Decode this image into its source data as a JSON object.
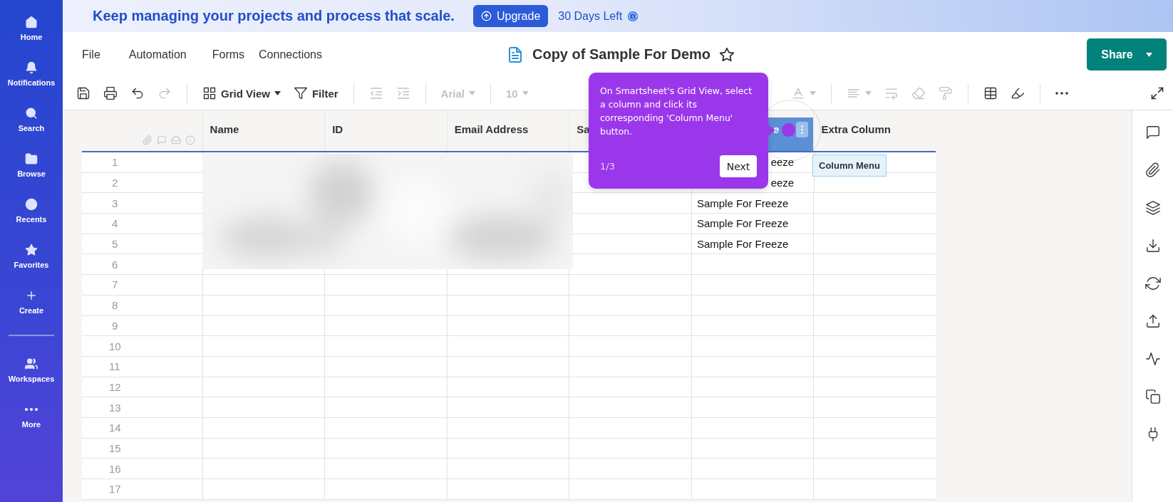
{
  "banner": {
    "message": "Keep managing your projects and process that scale.",
    "upgrade_button": "Upgrade",
    "trial_text": "30 Days Left"
  },
  "sidebar": {
    "items": [
      {
        "kind": "home",
        "label": "Home",
        "divider_before": false
      },
      {
        "kind": "bell",
        "label": "Notifications",
        "divider_before": false
      },
      {
        "kind": "search",
        "label": "Search",
        "divider_before": false
      },
      {
        "kind": "folder",
        "label": "Browse",
        "divider_before": false
      },
      {
        "kind": "clock",
        "label": "Recents",
        "divider_before": false
      },
      {
        "kind": "star",
        "label": "Favorites",
        "divider_before": false
      },
      {
        "kind": "plus",
        "label": "Create",
        "divider_before": false
      },
      {
        "kind": "workspaces",
        "label": "Workspaces",
        "divider_before": true
      },
      {
        "kind": "more",
        "label": "More",
        "divider_before": false
      }
    ]
  },
  "menu": [
    "File",
    "Automation",
    "Forms",
    "Connections"
  ],
  "document": {
    "title": "Copy of Sample For Demo",
    "starred": false
  },
  "share_button": {
    "label": "Share"
  },
  "toolbar": {
    "left_items": [
      {
        "kind": "save",
        "disabled": false,
        "dropdown": false
      },
      {
        "kind": "print",
        "disabled": false,
        "dropdown": false
      },
      {
        "kind": "undo",
        "disabled": false,
        "dropdown": false
      },
      {
        "kind": "redo",
        "disabled": true,
        "dropdown": false
      },
      {
        "kind": "divider"
      },
      {
        "kind": "grid-view",
        "label": "Grid View",
        "disabled": false,
        "dropdown": true
      },
      {
        "kind": "filter",
        "label": "Filter",
        "disabled": false,
        "dropdown": false
      },
      {
        "kind": "divider"
      },
      {
        "kind": "outdent",
        "disabled": true,
        "dropdown": false
      },
      {
        "kind": "indent",
        "disabled": true,
        "dropdown": false
      },
      {
        "kind": "divider"
      },
      {
        "kind": "font",
        "label": "Arial",
        "disabled": true,
        "dropdown": true
      },
      {
        "kind": "divider"
      },
      {
        "kind": "font-size",
        "label": "10",
        "disabled": true,
        "dropdown": true
      }
    ],
    "right_items": [
      {
        "kind": "text-color",
        "disabled": true,
        "dropdown": true
      },
      {
        "kind": "divider"
      },
      {
        "kind": "align",
        "disabled": true,
        "dropdown": true
      },
      {
        "kind": "wrap",
        "disabled": true,
        "dropdown": false
      },
      {
        "kind": "eraser",
        "disabled": true,
        "dropdown": false
      },
      {
        "kind": "paint-roller",
        "disabled": true,
        "dropdown": false
      },
      {
        "kind": "divider"
      },
      {
        "kind": "table",
        "disabled": false,
        "dropdown": false
      },
      {
        "kind": "highlighter",
        "disabled": false,
        "dropdown": false
      },
      {
        "kind": "divider"
      },
      {
        "kind": "more",
        "disabled": false,
        "dropdown": false
      }
    ]
  },
  "grid": {
    "columns": [
      {
        "label": "Name",
        "selected": false
      },
      {
        "label": "ID",
        "selected": false
      },
      {
        "label": "Email Address",
        "selected": false
      },
      {
        "label": "Sa",
        "selected": false
      },
      {
        "label": "e",
        "selected": true
      },
      {
        "label": "Extra Column",
        "selected": false
      }
    ],
    "rows": [
      {
        "number": "1",
        "column_5": {
          "text": "eeze",
          "clipped": true
        }
      },
      {
        "number": "2",
        "column_5": {
          "text": "eeze",
          "clipped": true
        }
      },
      {
        "number": "3",
        "column_5": {
          "text": "Sample For Freeze",
          "clipped": false
        }
      },
      {
        "number": "4",
        "column_5": {
          "text": "Sample For Freeze",
          "clipped": false
        }
      },
      {
        "number": "5",
        "column_5": {
          "text": "Sample For Freeze",
          "clipped": false
        }
      },
      {
        "number": "6"
      },
      {
        "number": "7"
      },
      {
        "number": "8"
      },
      {
        "number": "9"
      },
      {
        "number": "10"
      },
      {
        "number": "11"
      },
      {
        "number": "12"
      },
      {
        "number": "13"
      },
      {
        "number": "14"
      },
      {
        "number": "15"
      },
      {
        "number": "16"
      },
      {
        "number": "17"
      }
    ]
  },
  "column_menu_tooltip": "Column Menu",
  "tour": {
    "text": "On Smartsheet's Grid View, select a column and click its corresponding 'Column Menu' button.",
    "step": "1/3",
    "next_button": "Next"
  }
}
